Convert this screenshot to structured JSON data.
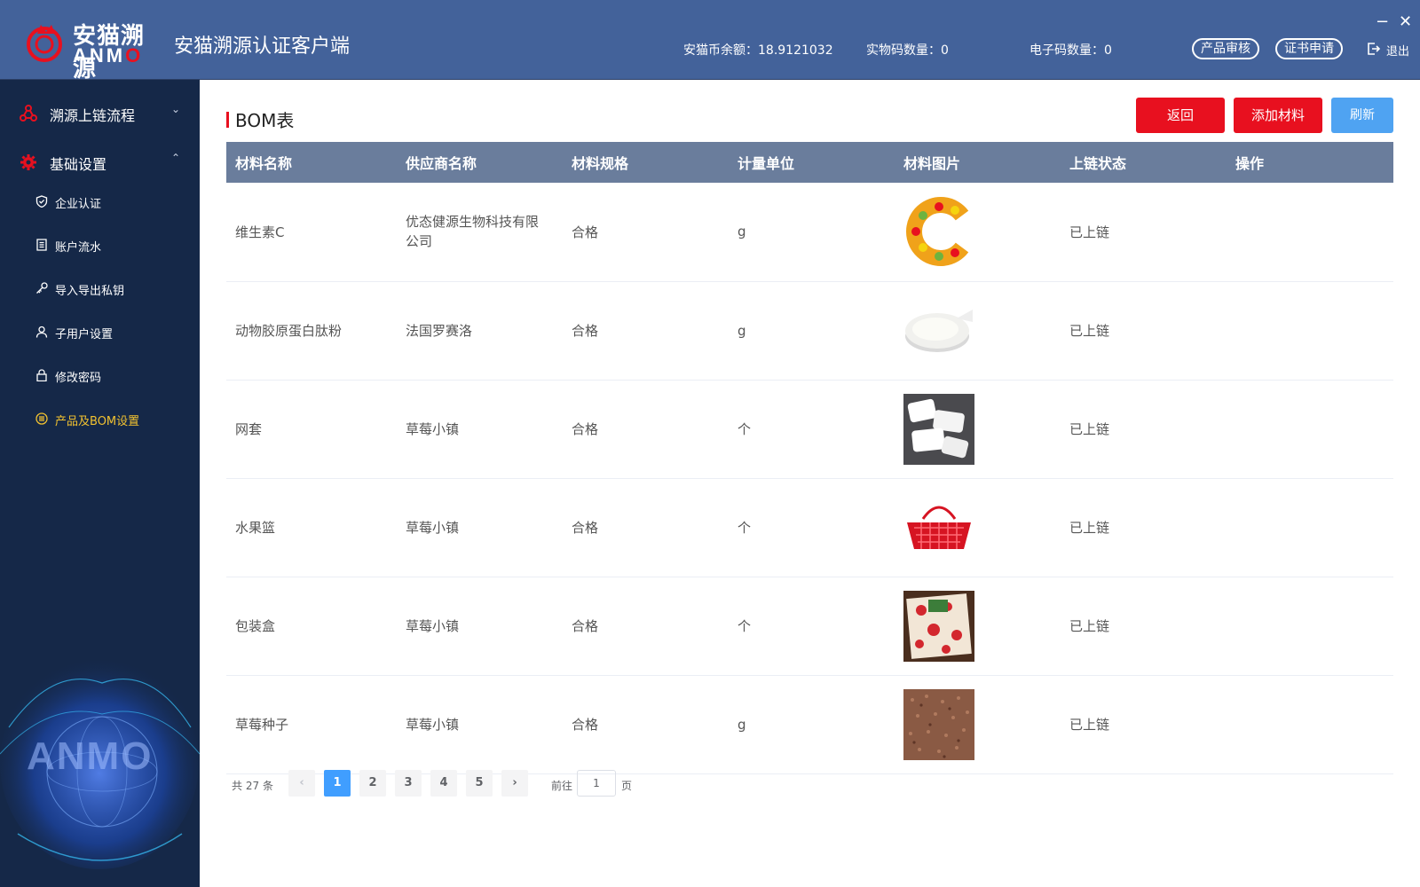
{
  "header": {
    "logo_cn": "安猫溯源",
    "logo_en_prefix": "ANM",
    "logo_en_suffix": "O",
    "app_title": "安猫溯源认证客户端",
    "balance": "安猫币余额：18.9121032",
    "physical_codes": "实物码数量：0",
    "electronic_codes": "电子码数量：0",
    "product_review": "产品审核",
    "cert_apply": "证书申请",
    "logout": "退出",
    "minimize": "−",
    "close": "✕"
  },
  "sidebar": {
    "groups": [
      {
        "label": "溯源上链流程",
        "chevron": "⌄"
      },
      {
        "label": "基础设置",
        "chevron": "⌃"
      }
    ],
    "items": [
      {
        "label": "企业认证",
        "icon": "shield-icon"
      },
      {
        "label": "账户流水",
        "icon": "document-icon"
      },
      {
        "label": "导入导出私钥",
        "icon": "key-icon"
      },
      {
        "label": "子用户设置",
        "icon": "user-icon"
      },
      {
        "label": "修改密码",
        "icon": "lock-icon"
      },
      {
        "label": "产品及BOM设置",
        "icon": "list-circle-icon"
      }
    ],
    "active_color": "#f2c230",
    "globe_text": "ANMO"
  },
  "main": {
    "title": "BOM表",
    "buttons": {
      "back": "返回",
      "add": "添加材料",
      "refresh": "刷新"
    },
    "columns": [
      "材料名称",
      "供应商名称",
      "材料规格",
      "计量单位",
      "材料图片",
      "上链状态",
      "操作"
    ],
    "rows": [
      {
        "name": "维生素C",
        "supplier": "优态健源生物科技有限公司",
        "spec": "合格",
        "unit": "g",
        "image": "vitamin-c-fruit-letter",
        "status": "已上链"
      },
      {
        "name": "动物胶原蛋白肽粉",
        "supplier": "法国罗赛洛",
        "spec": "合格",
        "unit": "g",
        "image": "white-powder-dish",
        "status": "已上链"
      },
      {
        "name": "网套",
        "supplier": "草莓小镇",
        "spec": "合格",
        "unit": "个",
        "image": "white-foam-nets",
        "status": "已上链"
      },
      {
        "name": "水果篮",
        "supplier": "草莓小镇",
        "spec": "合格",
        "unit": "个",
        "image": "red-fruit-basket",
        "status": "已上链"
      },
      {
        "name": "包装盒",
        "supplier": "草莓小镇",
        "spec": "合格",
        "unit": "个",
        "image": "strawberry-gift-box",
        "status": "已上链"
      },
      {
        "name": "草莓种子",
        "supplier": "草莓小镇",
        "spec": "合格",
        "unit": "g",
        "image": "brown-seeds",
        "status": "已上链"
      }
    ],
    "pagination": {
      "total_prefix": "共",
      "total": "27",
      "total_suffix": "条",
      "prev": "‹",
      "next": "›",
      "pages": [
        "1",
        "2",
        "3",
        "4",
        "5"
      ],
      "current": "1",
      "goto_label": "前往",
      "goto_value": "1",
      "page_label": "页"
    }
  },
  "colors": {
    "header_bg": "#43629a",
    "sidebar_bg": "#152848",
    "table_header_bg": "#6a7d9c",
    "brand_red": "#e8101f",
    "refresh_blue": "#4fa3f2"
  }
}
